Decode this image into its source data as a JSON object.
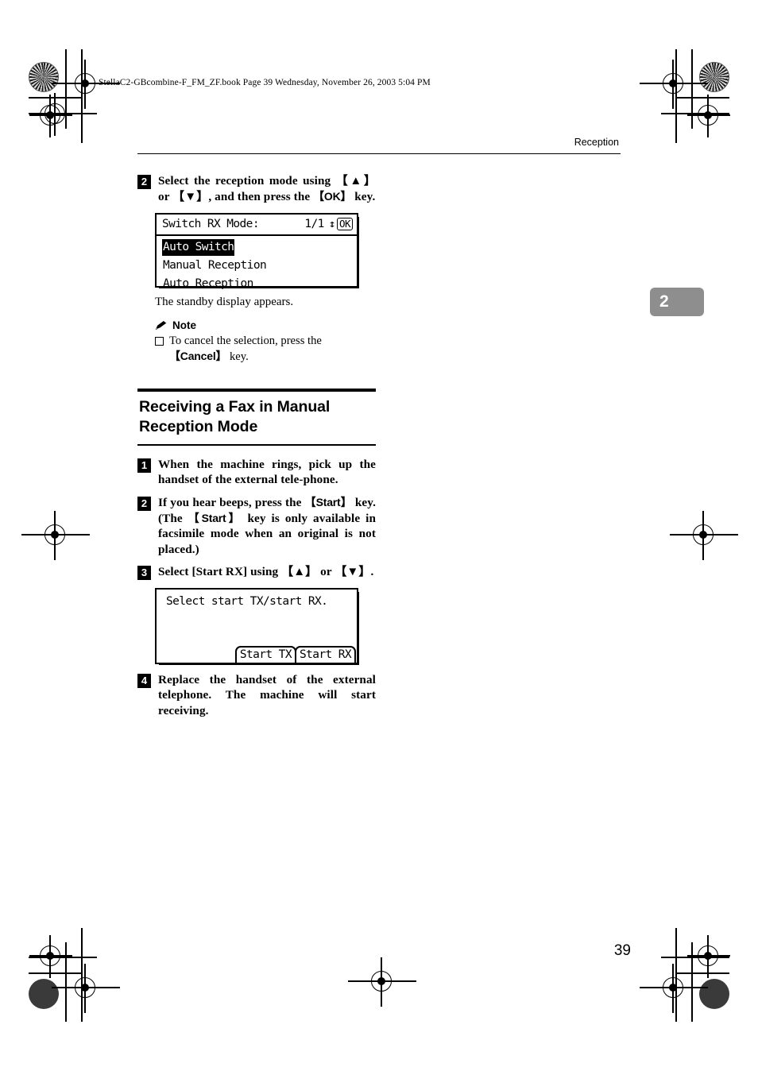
{
  "page": {
    "filename_line": "StellaC2-GBcombine-F_FM_ZF.book  Page 39  Wednesday, November 26, 2003  5:04 PM",
    "running_head": "Reception",
    "chapter_tab": "2",
    "page_number": "39"
  },
  "step2_top": {
    "badge": "2",
    "line1": "Select the reception mode using",
    "key_up": "【▲】",
    "mid": " or ",
    "key_down": "【▼】",
    "line2_tail": ", and then press the",
    "key_ok": "【OK】",
    "line3_tail": " key."
  },
  "lcd_switch_rx": {
    "title": "Switch RX Mode:",
    "page_indicator": "1/1",
    "updown_arrow": "↕",
    "ok_label": "OK",
    "items": [
      {
        "label": "Auto Switch",
        "selected": true
      },
      {
        "label": "Manual Reception",
        "selected": false
      },
      {
        "label": "Auto Reception",
        "selected": false
      }
    ]
  },
  "standby_text": "The standby display appears.",
  "note": {
    "heading": "Note",
    "body_line1": "To cancel the selection, press the",
    "key_cancel": "【Cancel】",
    "body_tail": " key."
  },
  "section": {
    "title_line1": "Receiving a Fax in Manual",
    "title_line2": "Reception Mode"
  },
  "step1": {
    "badge": "1",
    "text": "When the machine rings, pick up the handset of the external tele-phone."
  },
  "step2": {
    "badge": "2",
    "part1": "If you hear beeps, press the ",
    "key_start_a": "【Start】",
    "part2": " key. (The ",
    "key_start_b": "【Start】",
    "part3": " key is only available in facsimile mode when an original is not placed.)"
  },
  "step3": {
    "badge": "3",
    "part1": "Select [Start RX] using ",
    "key_up": "【▲】",
    "part2": " or ",
    "key_down": "【▼】",
    "part3": "."
  },
  "lcd_start": {
    "prompt": "Select start TX/start RX.",
    "tab_tx": "Start TX",
    "tab_rx": "Start RX"
  },
  "step4": {
    "badge": "4",
    "text": "Replace the handset of the external telephone. The machine will start receiving."
  }
}
